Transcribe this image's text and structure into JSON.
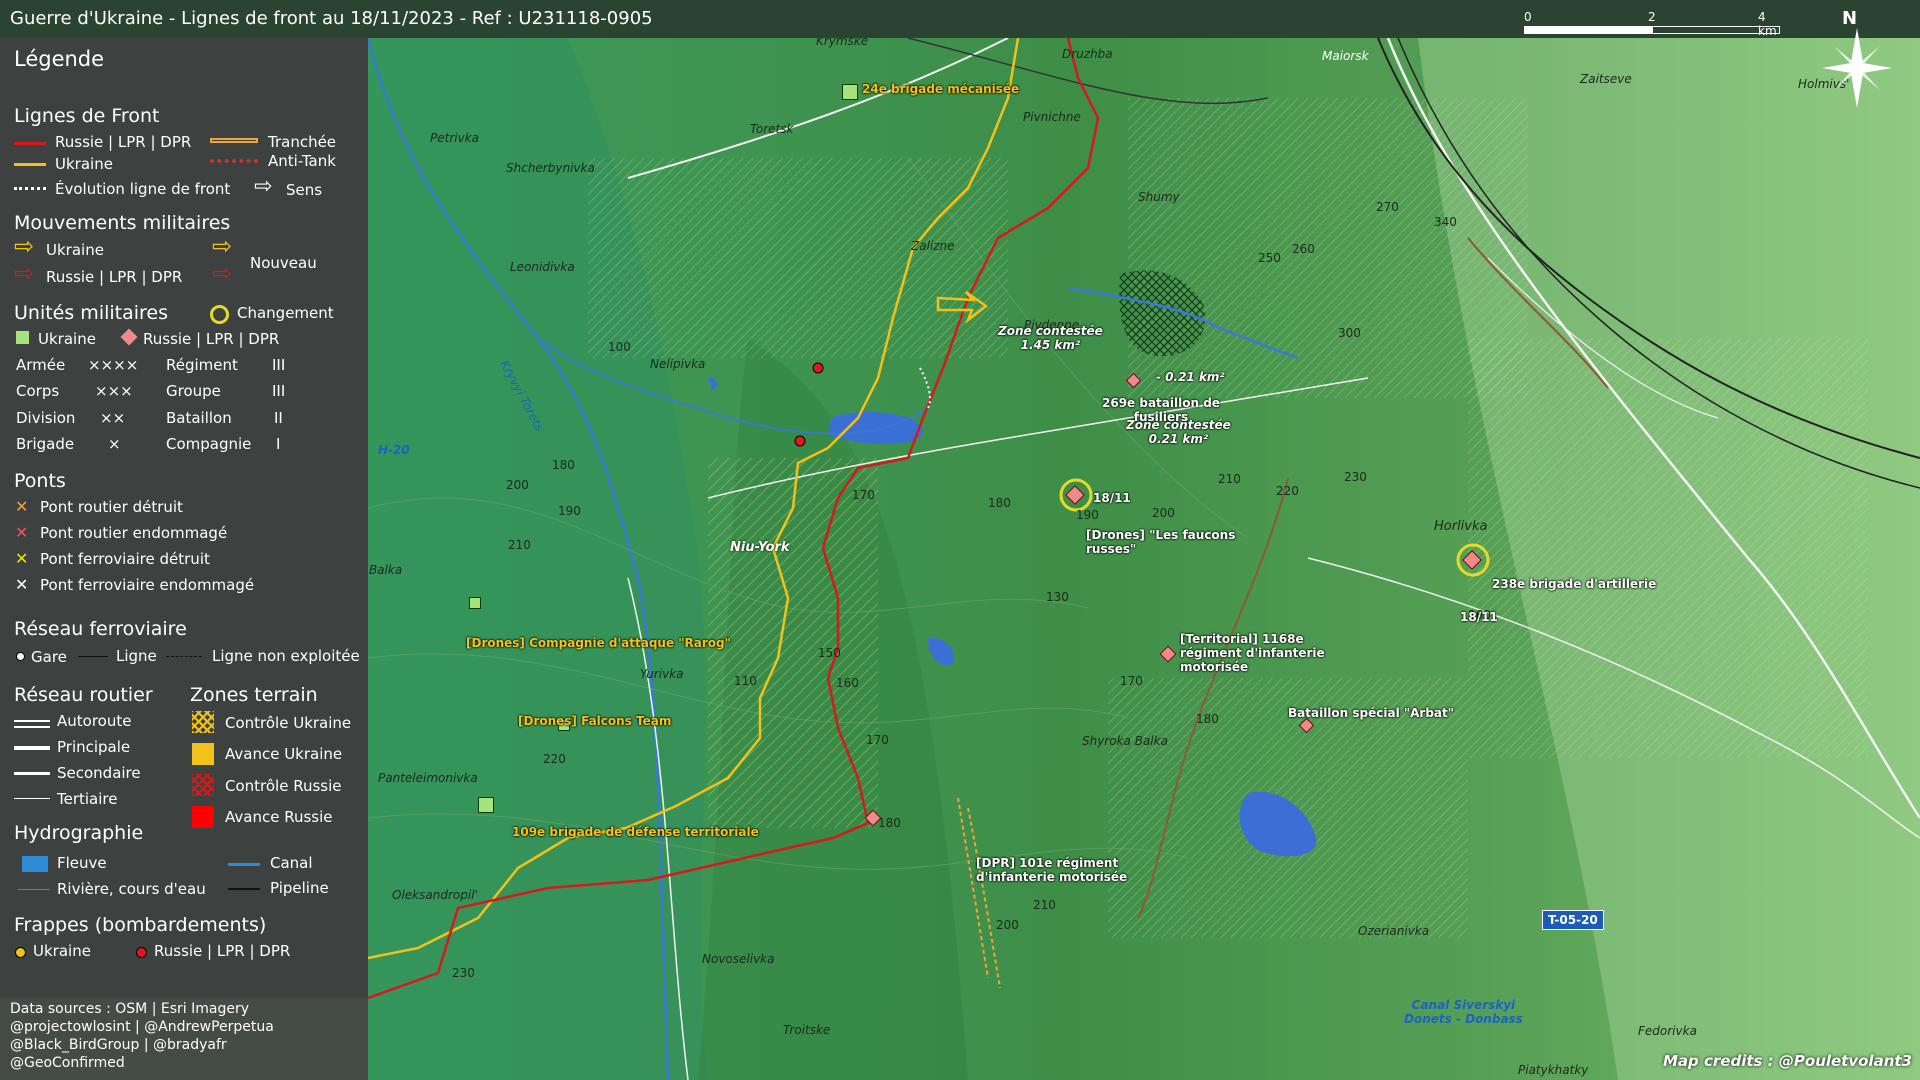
{
  "title": "Guerre d'Ukraine - Lignes de front au 18/11/2023 - Ref : U231118-0905",
  "scale": {
    "t0": "0",
    "t1": "2",
    "t2": "4 km"
  },
  "north": "N",
  "legend": {
    "title": "Légende",
    "front": {
      "heading": "Lignes de Front",
      "russia": "Russie | LPR | DPR",
      "ukraine": "Ukraine",
      "evolution": "Évolution ligne de front",
      "trench": "Tranchée",
      "antitank": "Anti-Tank",
      "direction": "Sens"
    },
    "moves": {
      "heading": "Mouvements militaires",
      "ukraine": "Ukraine",
      "russia": "Russie | LPR | DPR",
      "new": "Nouveau"
    },
    "units": {
      "heading": "Unités militaires",
      "change": "Changement",
      "ukraine": "Ukraine",
      "russia": "Russie | LPR | DPR",
      "rows": [
        {
          "a": "Armée",
          "as": "××××",
          "b": "Régiment",
          "bs": "III"
        },
        {
          "a": "Corps",
          "as": "×××",
          "b": "Groupe",
          "bs": "III"
        },
        {
          "a": "Division",
          "as": "××",
          "b": "Bataillon",
          "bs": "II"
        },
        {
          "a": "Brigade",
          "as": "×",
          "b": "Compagnie",
          "bs": "I"
        }
      ]
    },
    "bridges": {
      "heading": "Ponts",
      "items": [
        "Pont routier détruit",
        "Pont routier endommagé",
        "Pont ferroviaire détruit",
        "Pont ferroviaire endommagé"
      ]
    },
    "rail": {
      "heading": "Réseau ferroviaire",
      "station": "Gare",
      "line": "Ligne",
      "unused": "Ligne non exploitée"
    },
    "roads": {
      "heading": "Réseau routier",
      "items": [
        "Autoroute",
        "Principale",
        "Secondaire",
        "Tertiaire"
      ]
    },
    "zones": {
      "heading": "Zones terrain",
      "items": [
        "Contrôle Ukraine",
        "Avance Ukraine",
        "Contrôle Russie",
        "Avance Russie"
      ]
    },
    "hydro": {
      "heading": "Hydrographie",
      "river": "Fleuve",
      "stream": "Rivière, cours d'eau",
      "canal": "Canal",
      "pipeline": "Pipeline"
    },
    "strikes": {
      "heading": "Frappes (bombardements)",
      "ukraine": "Ukraine",
      "russia": "Russie | LPR | DPR"
    },
    "sources": [
      "Data sources : OSM | Esri Imagery",
      "@projectowlosint | @AndrewPerpetua",
      "@Black_BirdGroup | @bradyafr",
      "@GeoConfirmed"
    ]
  },
  "colors": {
    "russia": "#d7191c",
    "ukraine": "#f2c21a",
    "ukraine_unit": "#a6e37a",
    "russia_unit": "#f08a8a",
    "water": "#3b6fd6"
  },
  "places": [
    "Krymske",
    "Druzhba",
    "Maiorsk",
    "Zaitseve",
    "Holmivs'",
    "Toretsk",
    "Pivnichne",
    "Petrivka",
    "Shcherbynivka",
    "Shumy",
    "Zalizne",
    "Leonidivka",
    "Pivdenne",
    "Nelipivka",
    "Niu-York",
    "Horlivka",
    "Sukha Balka",
    "Yurivka",
    "Shyroka Balka",
    "Panteleimonivka",
    "Oleksandropil'",
    "Novoselivka",
    "Troitske",
    "Ozerianivka",
    "Fedorivka",
    "Piatykhatky",
    "Kryvyi Torets"
  ],
  "elevations": [
    "270",
    "340",
    "250",
    "260",
    "300",
    "100",
    "180",
    "200",
    "190",
    "210",
    "170",
    "180",
    "190",
    "200",
    "210",
    "220",
    "230",
    "130",
    "150",
    "160",
    "110",
    "170",
    "220",
    "180",
    "170",
    "180",
    "260",
    "210",
    "200",
    "230"
  ],
  "zones": {
    "z1": "Zone contestée",
    "z1a": "1.45 km²",
    "z2": "- 0.21 km²",
    "z3": "Zone contestée",
    "z3a": "0.21 km²"
  },
  "units": {
    "u24": "24e brigade mécanisée",
    "u269a": "269e bataillon de",
    "u269b": "fusiliers",
    "drones1a": "[Drones] \"Les faucons",
    "drones1b": "russes\"",
    "date1": "18/11",
    "u238": "238e brigade d'artillerie",
    "date2": "18/11",
    "u1168a": "[Territorial] 1168e",
    "u1168b": "régiment d'infanterie",
    "u1168c": "motorisée",
    "rarog": "[Drones] Compagnie d'attaque \"Rarog\"",
    "falcons": "[Drones] Falcons Team",
    "arbat": "Bataillon spécial \"Arbat\"",
    "u109": "109e brigade de défense territoriale",
    "dpra": "[DPR] 101e régiment",
    "dprb": "d'infanterie motorisée"
  },
  "road_badge": "T-05-20",
  "canal_label": {
    "a": "Canal Siverskyi",
    "b": "Donets - Donbass"
  },
  "road_h20": "H-20",
  "map_credits": "Map credits : @Pouletvolant3"
}
